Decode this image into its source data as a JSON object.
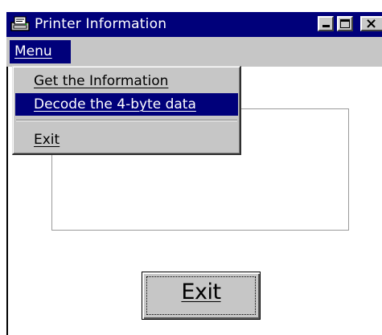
{
  "window": {
    "title": "Printer Information"
  },
  "menubar": {
    "menu_label": "Menu"
  },
  "dropdown": {
    "items": [
      {
        "label": "Get the Information",
        "selected": false
      },
      {
        "label": "Decode the 4-byte data",
        "selected": true
      },
      {
        "label": "Exit",
        "selected": false
      }
    ]
  },
  "main": {
    "exit_button_label": "Exit"
  },
  "colors": {
    "title_bar": "#00007a",
    "face": "#c6c6c6",
    "highlight": "#00007a"
  }
}
